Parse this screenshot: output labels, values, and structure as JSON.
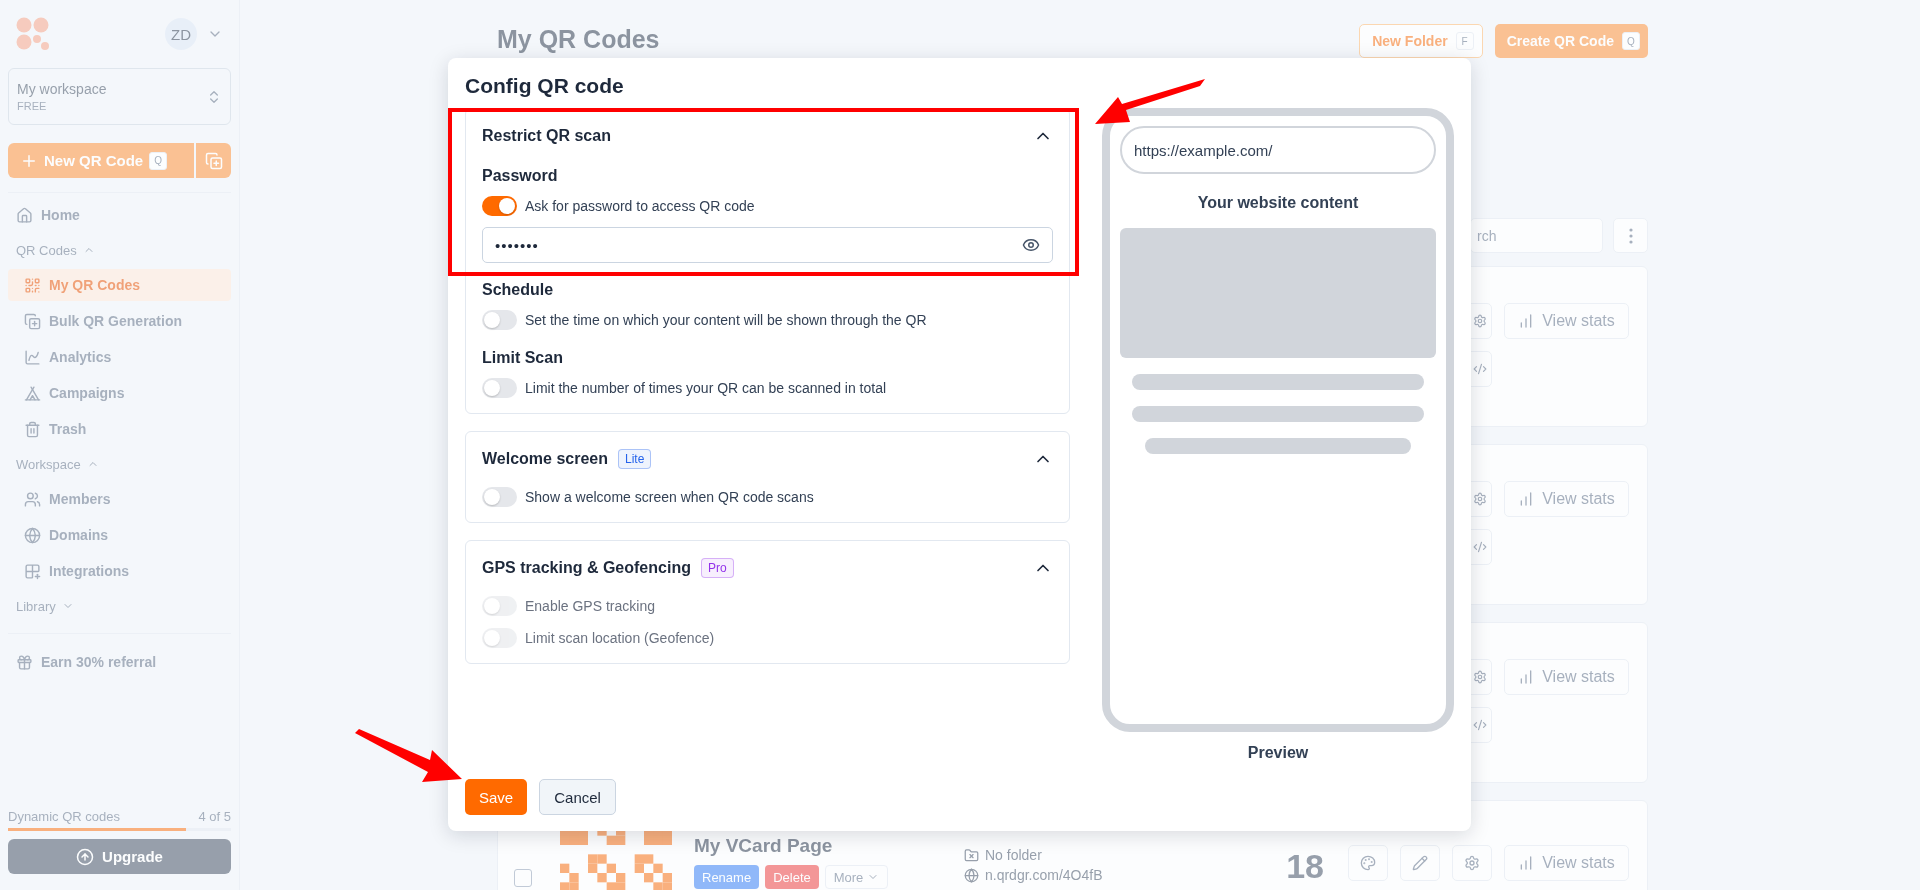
{
  "sidebar": {
    "avatar": "ZD",
    "workspace": {
      "name": "My workspace",
      "plan": "FREE"
    },
    "new_button": {
      "label": "New QR Code",
      "shortcut": "Q"
    },
    "nav": [
      {
        "kind": "link",
        "label": "Home",
        "selected": false
      },
      {
        "kind": "group",
        "label": "QR Codes",
        "expanded": true,
        "children": [
          {
            "label": "My QR Codes",
            "selected": true
          },
          {
            "label": "Bulk QR Generation",
            "selected": false
          },
          {
            "label": "Analytics",
            "selected": false
          },
          {
            "label": "Campaigns",
            "selected": false
          },
          {
            "label": "Trash",
            "selected": false
          }
        ]
      },
      {
        "kind": "group",
        "label": "Workspace",
        "expanded": true,
        "children": [
          {
            "label": "Members",
            "selected": false
          },
          {
            "label": "Domains",
            "selected": false
          },
          {
            "label": "Integrations",
            "selected": false
          }
        ]
      },
      {
        "kind": "group",
        "label": "Library",
        "expanded": false
      }
    ],
    "referral": "Earn 30% referral",
    "usage": {
      "label": "Dynamic QR codes",
      "count": "4 of 5",
      "level": 0.8
    },
    "upgrade": "Upgrade"
  },
  "page": {
    "title": "My QR Codes",
    "new_folder": {
      "label": "New Folder",
      "shortcut": "F"
    },
    "create": {
      "label": "Create QR Code",
      "shortcut": "Q"
    },
    "search": {
      "placeholder": "rch"
    },
    "cards": [
      {
        "kind": "actions",
        "view_stats": "View stats"
      },
      {
        "kind": "actions",
        "view_stats": "View stats"
      },
      {
        "kind": "actions",
        "view_stats": "View stats"
      },
      {
        "kind": "full",
        "checked": false,
        "title": "My VCard Page",
        "buttons": [
          "Rename",
          "Delete",
          "More"
        ],
        "folder": "No folder",
        "link": "n.qrdgr.com/4O4fB",
        "scans": "18",
        "view_stats": "View stats"
      }
    ]
  },
  "dialog": {
    "title": "Config QR code",
    "sections": [
      {
        "title": "Restrict QR scan",
        "expanded": true,
        "groups": [
          {
            "heading": "Password",
            "toggles": [
              {
                "label": "Ask for password to access QR code",
                "on": true,
                "disabled": false
              }
            ],
            "password": "•••••••"
          },
          {
            "heading": "Schedule",
            "toggles": [
              {
                "label": "Set the time on which your content will be shown through the QR",
                "on": false,
                "disabled": false
              }
            ]
          },
          {
            "heading": "Limit Scan",
            "toggles": [
              {
                "label": "Limit the number of times your QR can be scanned in total",
                "on": false,
                "disabled": false
              }
            ]
          }
        ]
      },
      {
        "title": "Welcome screen",
        "badge": {
          "text": "Lite",
          "color": "#2563eb"
        },
        "expanded": true,
        "groups": [
          {
            "toggles": [
              {
                "label": "Show a welcome screen when QR code scans",
                "on": false,
                "disabled": false
              }
            ]
          }
        ]
      },
      {
        "title": "GPS tracking & Geofencing",
        "badge": {
          "text": "Pro",
          "color": "#9333ea"
        },
        "expanded": true,
        "groups": [
          {
            "toggles": [
              {
                "label": "Enable GPS tracking",
                "on": false,
                "disabled": true
              },
              {
                "label": "Limit scan location (Geofence)",
                "on": false,
                "disabled": true
              }
            ]
          }
        ]
      }
    ],
    "preview": {
      "url": "https://example.com/",
      "heading": "Your website content",
      "caption": "Preview"
    },
    "buttons": [
      {
        "label": "Save",
        "kind": "primary"
      },
      {
        "label": "Cancel",
        "kind": "secondary"
      }
    ]
  }
}
